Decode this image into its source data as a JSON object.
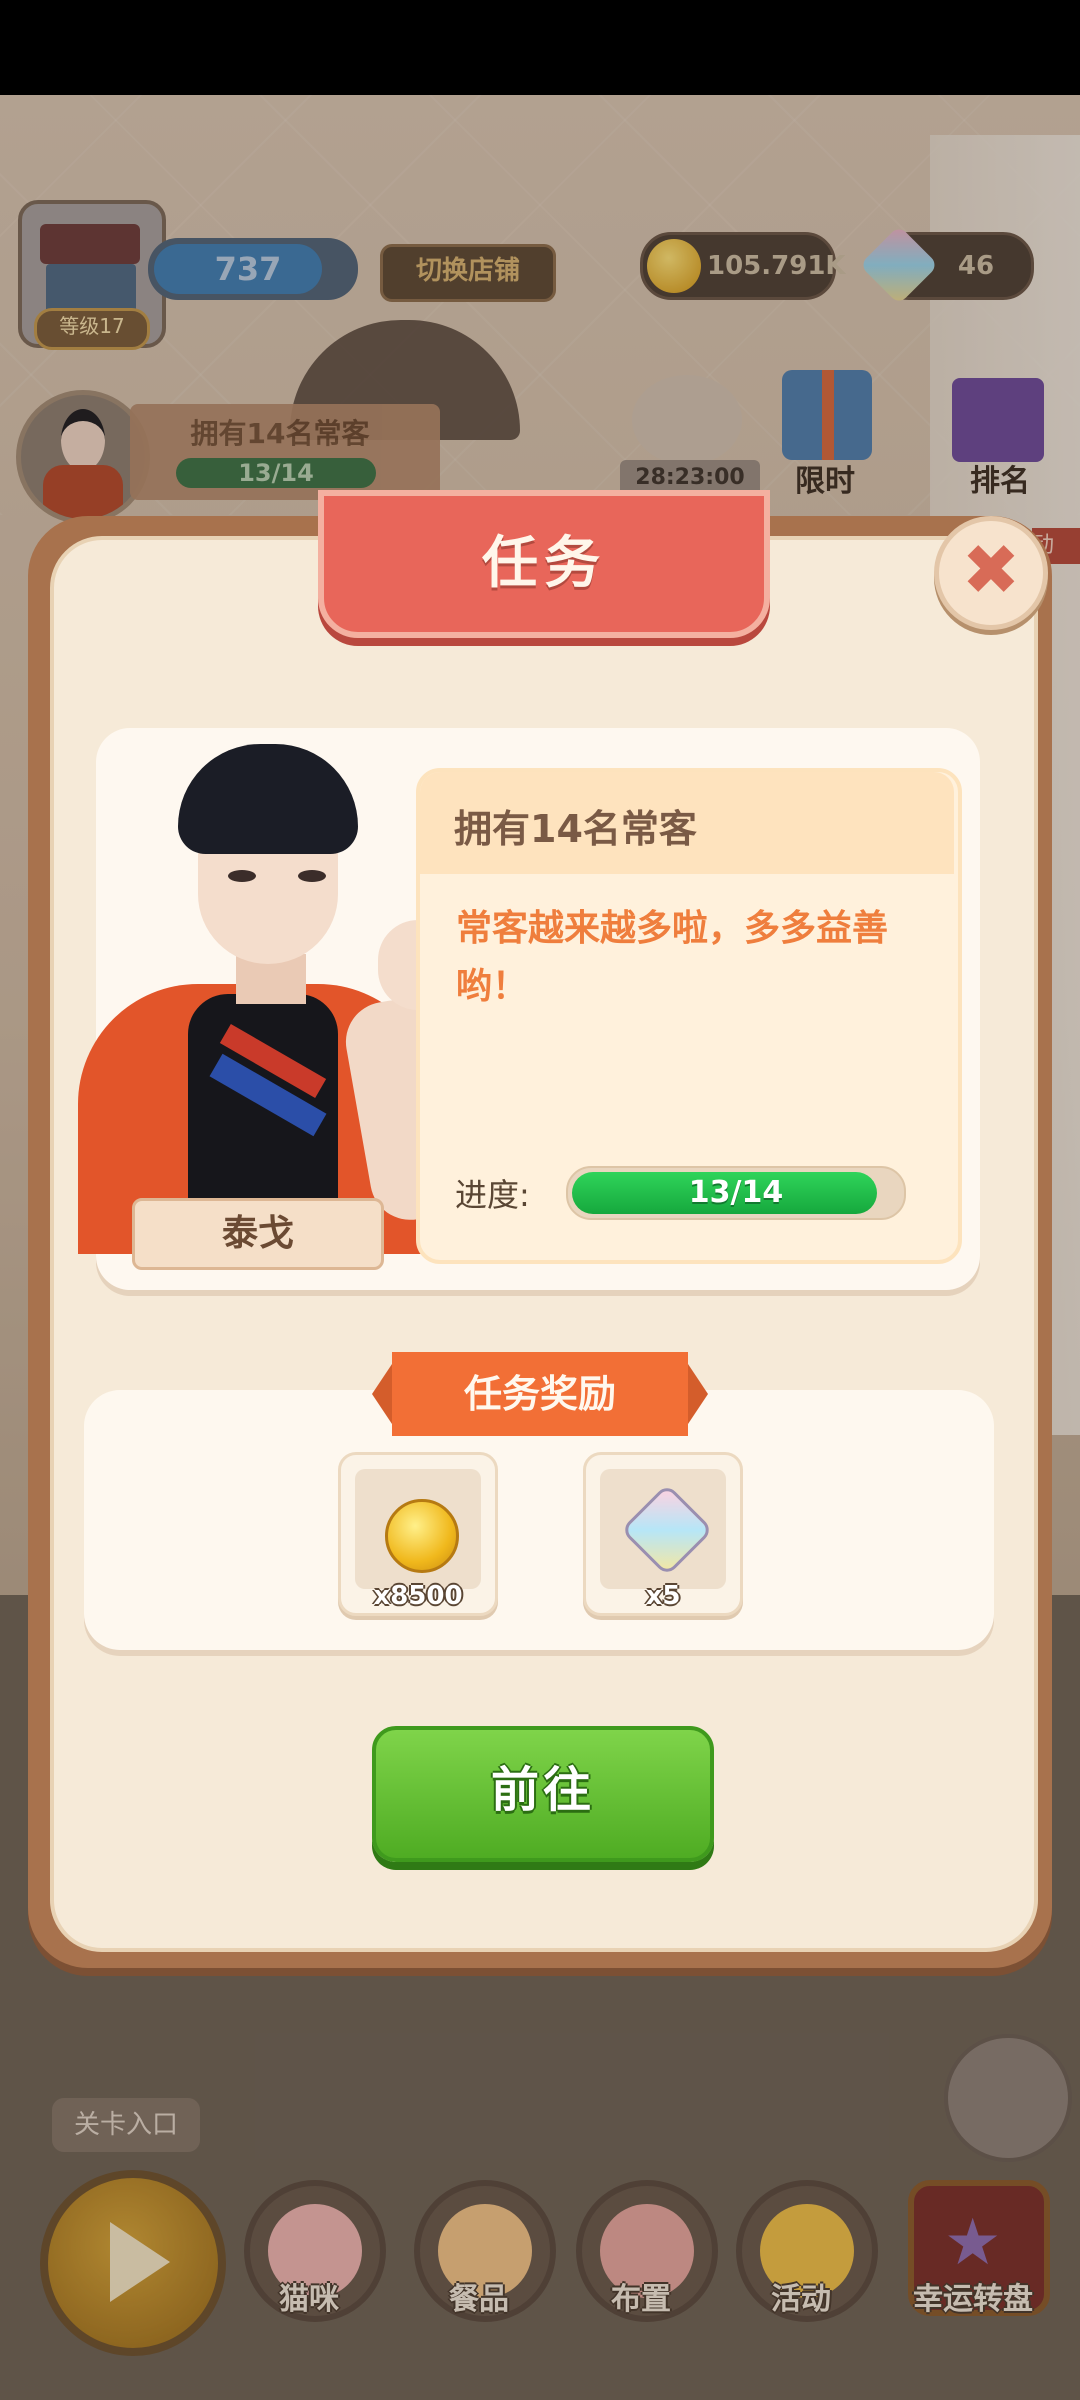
{
  "hud": {
    "level": "等级17",
    "xp_value": "737",
    "xp_fraction": 0.85,
    "switch_shop_label": "切换店铺",
    "coins": "105.791K",
    "gems": "46",
    "customer_task_title": "拥有14名常客",
    "customer_task_progress": "13/14",
    "timer": "28:23:00",
    "limited_label": "限时",
    "rank_label": "排名",
    "side_label": "动"
  },
  "modal": {
    "title": "任务",
    "task_name": "拥有14名常客",
    "description": "常客越来越多啦，多多益善哟！",
    "character_name": "泰戈",
    "progress_label": "进度:",
    "progress_text": "13/14",
    "progress_fraction": 0.929,
    "reward_title": "任务奖励",
    "rewards": [
      {
        "icon": "gold-coin-icon",
        "qty": "x8500"
      },
      {
        "icon": "gem-icon",
        "qty": "x5"
      }
    ],
    "go_button_label": "前往"
  },
  "bottom_nav": {
    "level_entry_label": "关卡入口",
    "items": [
      {
        "label": "猫咪",
        "icon": "cat-paw-icon",
        "color": "#f0b6b4"
      },
      {
        "label": "餐品",
        "icon": "donut-icon",
        "color": "#f2c48a"
      },
      {
        "label": "布置",
        "icon": "brush-icon",
        "color": "#e7a7a0"
      },
      {
        "label": "活动",
        "icon": "pinwheel-icon",
        "color": "#f0c04a"
      },
      {
        "label": "幸运转盘",
        "icon": "lucky-wheel-icon",
        "color": "#8f6db4"
      }
    ]
  },
  "colors": {
    "modal_border": "#a8724d",
    "modal_bg": "#f6ead8",
    "title_ribbon": "#e8665a",
    "reward_ribbon": "#f26f36",
    "progress_fill": "#22c24a",
    "go_button": "#5fbf2e",
    "description_text": "#ef7e3d"
  }
}
